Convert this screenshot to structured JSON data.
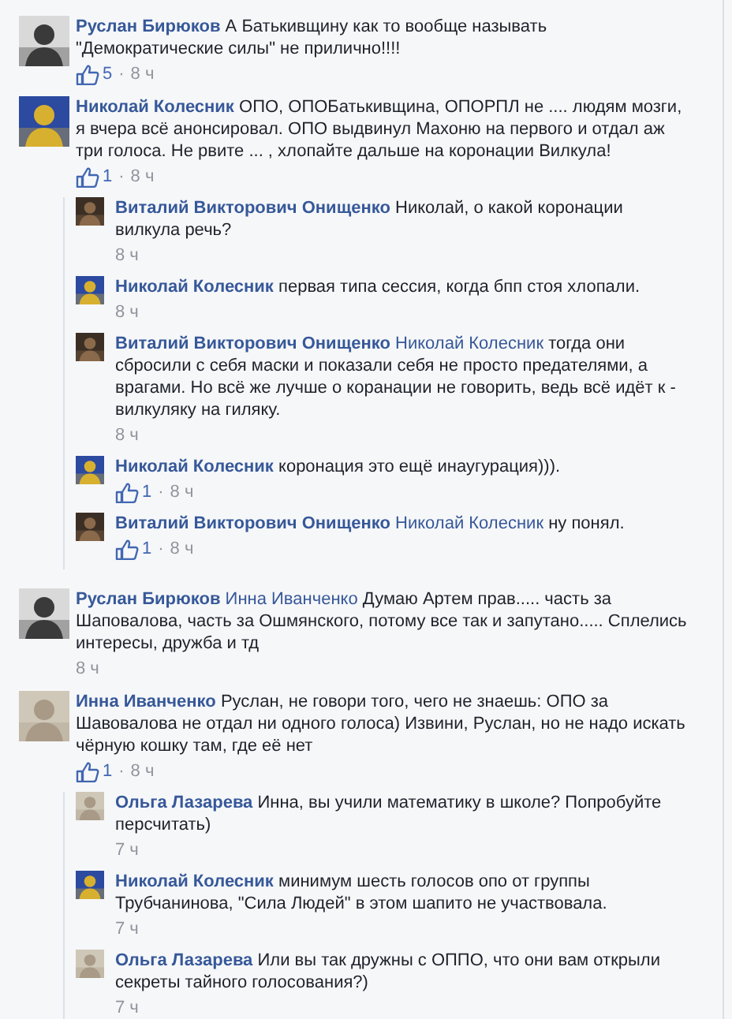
{
  "comments": [
    {
      "author": "Руслан Бирюков",
      "text": "А Батькивщину как то вообще называть \"Демократические силы\" не прилично!!!!",
      "likes": "5",
      "separator": "·",
      "time": "8 ч"
    },
    {
      "author": "Николай Колесник",
      "text": "ОПО, ОПОБатькивщина, ОПОРПЛ не .... людям мозги, я вчера всё анонсировал. ОПО выдвинул Махоню на первого и отдал аж три голоса. Не рвите ... , хлопайте дальше на коронации Вилкула!",
      "likes": "1",
      "separator": "·",
      "time": "8 ч",
      "children": [
        {
          "author": "Виталий Викторович Онищенко",
          "text": "Николай, о какой коронации вилкула речь?",
          "time": "8 ч"
        },
        {
          "author": "Николай Колесник",
          "text": "первая типа сессия, когда бпп стоя хлопали.",
          "time": "8 ч"
        },
        {
          "author": "Виталий Викторович Онищенко",
          "mention": "Николай Колесник",
          "text": "тогда они сбросили с себя маски и показали себя не просто предателями, а врагами. Но всё же лучше о коранации не говорить, ведь всё идёт к - вилкуляку на гиляку.",
          "time": "8 ч"
        },
        {
          "author": "Николай Колесник",
          "text": "коронация это ещё инаугурация))).",
          "likes": "1",
          "separator": "·",
          "time": "8 ч"
        },
        {
          "author": "Виталий Викторович Онищенко",
          "mention": "Николай Колесник",
          "text": "ну понял.",
          "likes": "1",
          "separator": "·",
          "time": "8 ч"
        }
      ]
    },
    {
      "author": "Руслан Бирюков",
      "mention": "Инна Иванченко",
      "text": "Думаю Артем прав..... часть за Шаповалова, часть за Ошмянского, потому все так и запутано..... Сплелись интересы, дружба и тд",
      "time": "8 ч"
    },
    {
      "author": "Инна Иванченко",
      "text": "Руслан, не говори того, чего не знаешь: ОПО за Шавовалова не отдал ни одного голоса) Извини, Руслан, но не надо искать чёрную кошку там, где её нет",
      "likes": "1",
      "separator": "·",
      "time": "8 ч",
      "children": [
        {
          "author": "Ольга Лазарева",
          "text": "Инна, вы учили математику в школе? Попробуйте персчитать)",
          "time": "7 ч"
        },
        {
          "author": "Николай Колесник",
          "text": "минимум шесть голосов опо от группы Трубчанинова, \"Сила Людей\" в этом шапито не участвовала.",
          "time": "7 ч"
        },
        {
          "author": "Ольга Лазарева",
          "text": "Или вы так дружны с ОППО, что они вам открыли секреты тайного голосования?)",
          "time": "7 ч"
        }
      ]
    }
  ]
}
